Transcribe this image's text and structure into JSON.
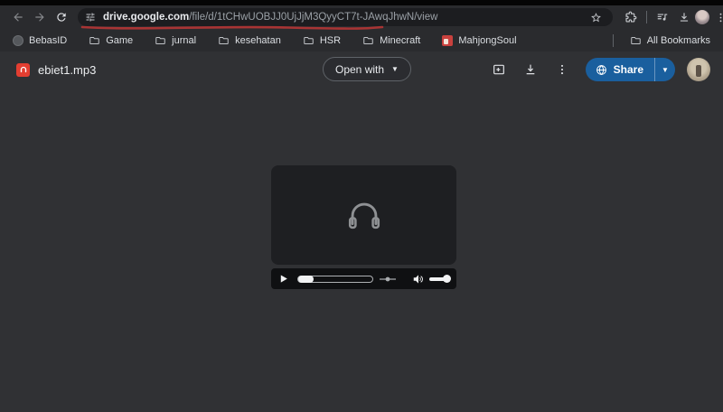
{
  "colors": {
    "toolbar_bg": "#2a2b2e",
    "omnibox_bg": "#1c1d20",
    "page_bg": "#303134",
    "player_card_bg": "#1e1f22",
    "controls_bg": "#0f1012",
    "share_blue": "#1a5f9e",
    "annotation_red": "#a83434",
    "mp3_icon_red": "#e33e31",
    "mahjong_icon_red": "#c9413e"
  },
  "browser": {
    "omnibox": {
      "domain": "drive.google.com",
      "path": "/file/d/1tCHwUOBJJ0UjJjM3QyyCT7t-JAwqJhwN/view"
    },
    "toolbar_icons": [
      "back-icon",
      "forward-icon",
      "reload-icon",
      "site-info-tune-icon",
      "bookmark-star-icon",
      "extensions-icon",
      "media-controls-icon",
      "downloads-icon",
      "profile-avatar",
      "menu-kebab-icon"
    ],
    "bookmarks_bar": {
      "items": [
        {
          "label": "BebasID",
          "icon": "site-favicon"
        },
        {
          "label": "Game",
          "icon": "folder-icon"
        },
        {
          "label": "jurnal",
          "icon": "folder-icon"
        },
        {
          "label": "kesehatan",
          "icon": "folder-icon"
        },
        {
          "label": "HSR",
          "icon": "folder-icon"
        },
        {
          "label": "Minecraft",
          "icon": "folder-icon"
        },
        {
          "label": "MahjongSoul",
          "icon": "mahjongsoul-favicon"
        }
      ],
      "all_bookmarks_label": "All Bookmarks"
    }
  },
  "drive": {
    "header": {
      "file_name": "ebiet1.mp3",
      "file_icon": "audio-file-icon",
      "open_with_label": "Open with",
      "action_icons": [
        "add-shortcut-to-drive-icon",
        "download-icon",
        "more-actions-icon"
      ],
      "share_label": "Share",
      "share_icon": "globe-icon"
    },
    "player": {
      "artwork_icon": "headphones-icon",
      "control_icons": [
        "play-icon",
        "seek-slider",
        "seek-marker-icon",
        "volume-icon",
        "volume-slider"
      ]
    }
  }
}
